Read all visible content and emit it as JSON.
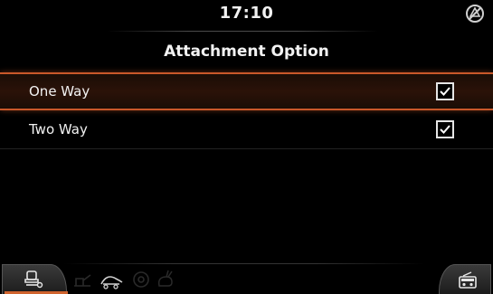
{
  "status": {
    "time": "17:10"
  },
  "screen": {
    "title": "Attachment Option"
  },
  "options": [
    {
      "label": "One Way",
      "checked": true,
      "selected": true
    },
    {
      "label": "Two Way",
      "checked": true,
      "selected": false
    }
  ],
  "bottom_bar": {
    "left_tab_icon": "operator-seat-icon",
    "faded_icons": [
      "machine-icon",
      "turtle-speed-icon",
      "gear-icon",
      "rabbit-speed-icon"
    ],
    "right_tab_icon": "radio-icon"
  },
  "colors": {
    "accent": "#c8582a",
    "background": "#000000",
    "text": "#f2f2f2"
  }
}
